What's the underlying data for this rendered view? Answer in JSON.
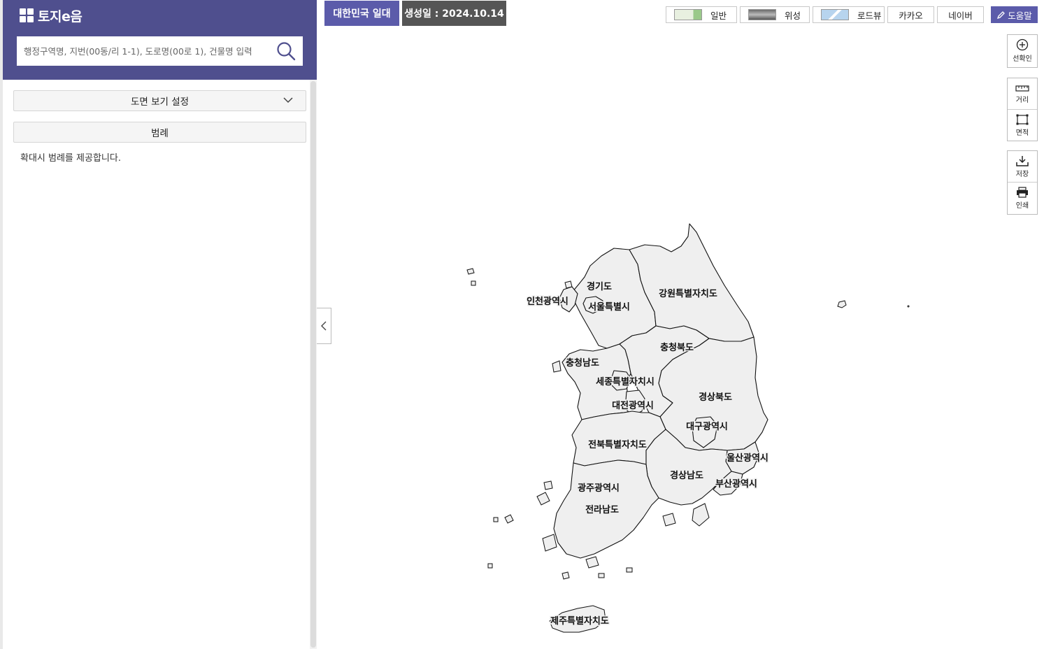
{
  "header": {
    "logo_text": "토지e음",
    "search_placeholder": "행정구역명, 지번(00동/리 1-1), 도로명(00로 1), 건물명 입력"
  },
  "panel": {
    "view_settings": "도면 보기 설정",
    "legend": "범례",
    "legend_message": "확대시 범례를 제공합니다."
  },
  "topbar": {
    "region": "대한민국 일대",
    "created": "생성일 : 2024.10.14",
    "map_types": [
      "일반",
      "위성",
      "로드뷰",
      "카카오",
      "네이버"
    ],
    "help": "도움말"
  },
  "tools": {
    "confirm": "선확인",
    "distance": "거리",
    "area": "면적",
    "save": "저장",
    "print": "인쇄"
  },
  "map": {
    "regions": [
      "경기도",
      "인천광역시",
      "서울특별시",
      "강원특별자치도",
      "충청북도",
      "충청남도",
      "세종특별자치시",
      "대전광역시",
      "경상북도",
      "대구광역시",
      "전북특별자치도",
      "울산광역시",
      "경상남도",
      "부산광역시",
      "광주광역시",
      "전라남도",
      "제주특별자치도"
    ]
  },
  "colors": {
    "header": "#4f4f8e",
    "accent": "#5b5baa",
    "date_badge": "#555555",
    "region_fill": "#efefef"
  }
}
